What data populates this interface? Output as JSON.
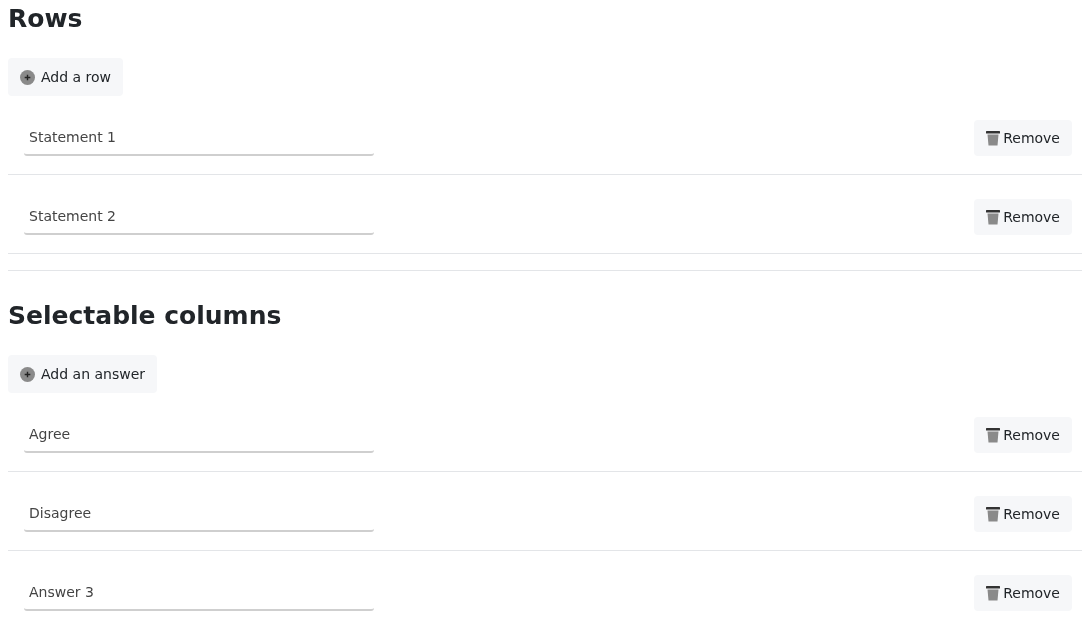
{
  "sections": [
    {
      "title": "Rows",
      "add_button": "Add a row",
      "items": [
        {
          "value": "Statement 1",
          "remove": "Remove"
        },
        {
          "value": "Statement 2",
          "remove": "Remove"
        }
      ]
    },
    {
      "title": "Selectable columns",
      "add_button": "Add an answer",
      "items": [
        {
          "value": "Agree",
          "remove": "Remove"
        },
        {
          "value": "Disagree",
          "remove": "Remove"
        },
        {
          "value": "Answer 3",
          "remove": "Remove"
        }
      ]
    }
  ]
}
